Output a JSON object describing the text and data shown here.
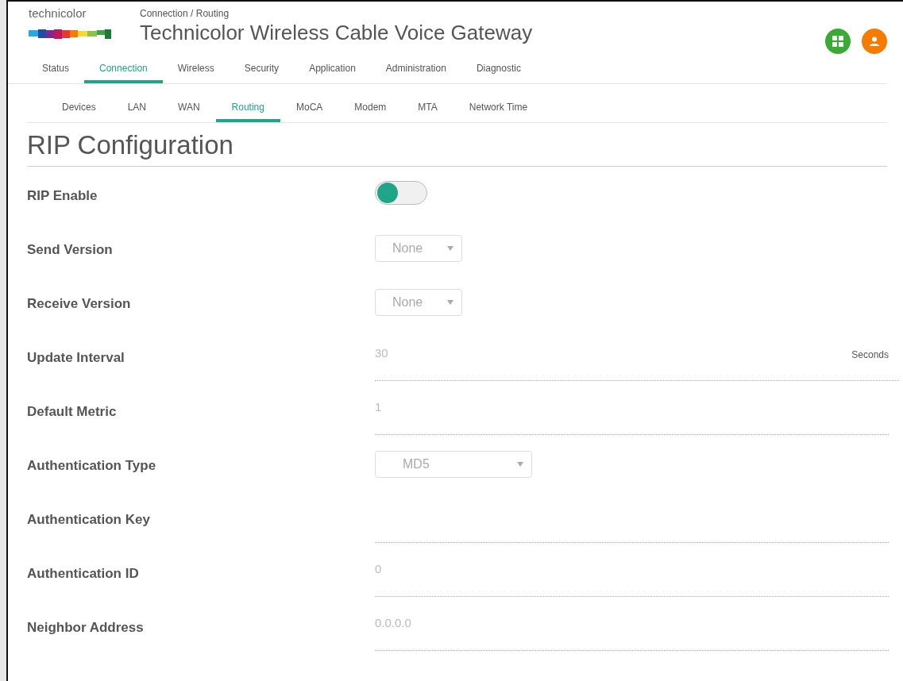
{
  "header": {
    "brand": "technicolor",
    "breadcrumb": "Connection / Routing",
    "title": "Technicolor Wireless Cable Voice Gateway"
  },
  "main_tabs": [
    {
      "label": "Status",
      "selected": false
    },
    {
      "label": "Connection",
      "selected": true
    },
    {
      "label": "Wireless",
      "selected": false
    },
    {
      "label": "Security",
      "selected": false
    },
    {
      "label": "Application",
      "selected": false
    },
    {
      "label": "Administration",
      "selected": false
    },
    {
      "label": "Diagnostic",
      "selected": false
    }
  ],
  "sub_tabs": [
    {
      "label": "Devices",
      "selected": false
    },
    {
      "label": "LAN",
      "selected": false
    },
    {
      "label": "WAN",
      "selected": false
    },
    {
      "label": "Routing",
      "selected": true
    },
    {
      "label": "MoCA",
      "selected": false
    },
    {
      "label": "Modem",
      "selected": false
    },
    {
      "label": "MTA",
      "selected": false
    },
    {
      "label": "Network Time",
      "selected": false
    }
  ],
  "heading": "RIP Configuration",
  "fields": [
    {
      "kind": "toggle",
      "label": "RIP Enable",
      "on": false
    },
    {
      "kind": "select",
      "label": "Send Version",
      "value": "None"
    },
    {
      "kind": "select",
      "label": "Receive Version",
      "value": "None"
    },
    {
      "kind": "input",
      "label": "Update Interval",
      "value": "30",
      "unit": "Seconds"
    },
    {
      "kind": "input",
      "label": "Default Metric",
      "value": "1"
    },
    {
      "kind": "wideselect",
      "label": "Authentication Type",
      "value": "MD5"
    },
    {
      "kind": "input",
      "label": "Authentication Key"
    },
    {
      "kind": "input",
      "label": "Authentication ID",
      "value": "0"
    },
    {
      "kind": "input",
      "label": "Neighbor Address",
      "value": "0.0.0.0"
    }
  ]
}
